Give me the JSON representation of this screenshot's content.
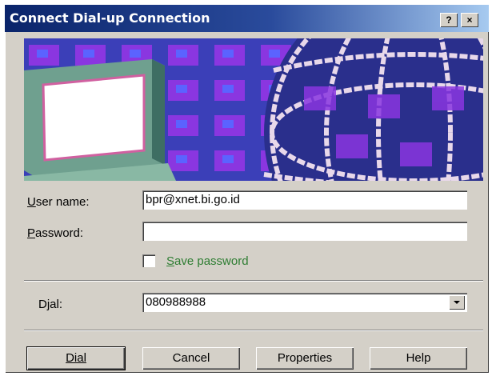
{
  "window": {
    "title": "Connect Dial-up Connection",
    "help_glyph": "?",
    "close_glyph": "×"
  },
  "form": {
    "username": {
      "label_accel": "U",
      "label_rest": "ser name:",
      "value": "bpr@xnet.bi.go.id"
    },
    "password": {
      "label_accel": "P",
      "label_rest": "assword:",
      "value": ""
    },
    "save_password": {
      "label_accel": "S",
      "label_rest": "ave password",
      "checked": false
    },
    "dial": {
      "label": "Djal:",
      "value": "080988988"
    }
  },
  "buttons": {
    "dial": "Dial",
    "cancel": "Cancel",
    "properties": "Properties",
    "help": "Help"
  },
  "colors": {
    "title_start": "#0a246a",
    "title_end": "#a6caf0",
    "face": "#d4d0c8",
    "save_label": "#2e7d32"
  },
  "icons": {
    "banner": "computer-and-globe-illustration",
    "dropdown": "chevron-down-icon"
  }
}
